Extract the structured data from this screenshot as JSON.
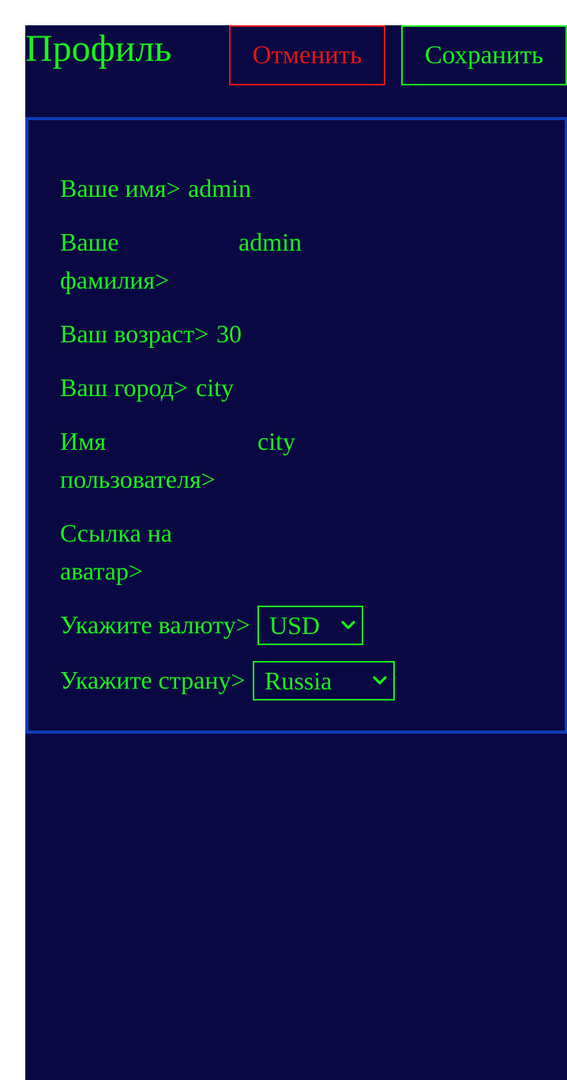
{
  "header": {
    "title": "Профиль",
    "cancel_label": "Отменить",
    "save_label": "Сохранить"
  },
  "profile": {
    "first_name": {
      "label": "Ваше имя>",
      "value": "admin"
    },
    "last_name": {
      "label_line1": "Ваше",
      "label_line2": "фамилия>",
      "value": "admin"
    },
    "age": {
      "label": "Ваш возраст>",
      "value": "30"
    },
    "city": {
      "label": "Ваш город>",
      "value": "city"
    },
    "username": {
      "label_line1": "Имя",
      "label_line2": "пользователя>",
      "value": "city"
    },
    "avatar": {
      "label_line1": "Ссылка на",
      "label_line2": "аватар>",
      "value": ""
    },
    "currency": {
      "label": "Укажите валюту>",
      "selected": "USD"
    },
    "country": {
      "label": "Укажите страну>",
      "selected": "Russia"
    }
  },
  "colors": {
    "background": "#0a0843",
    "text": "#19f219",
    "cancel": "#e21616",
    "panel_border": "#0f3db8"
  },
  "icons": {
    "select_arrow": "chevron-down-icon"
  }
}
